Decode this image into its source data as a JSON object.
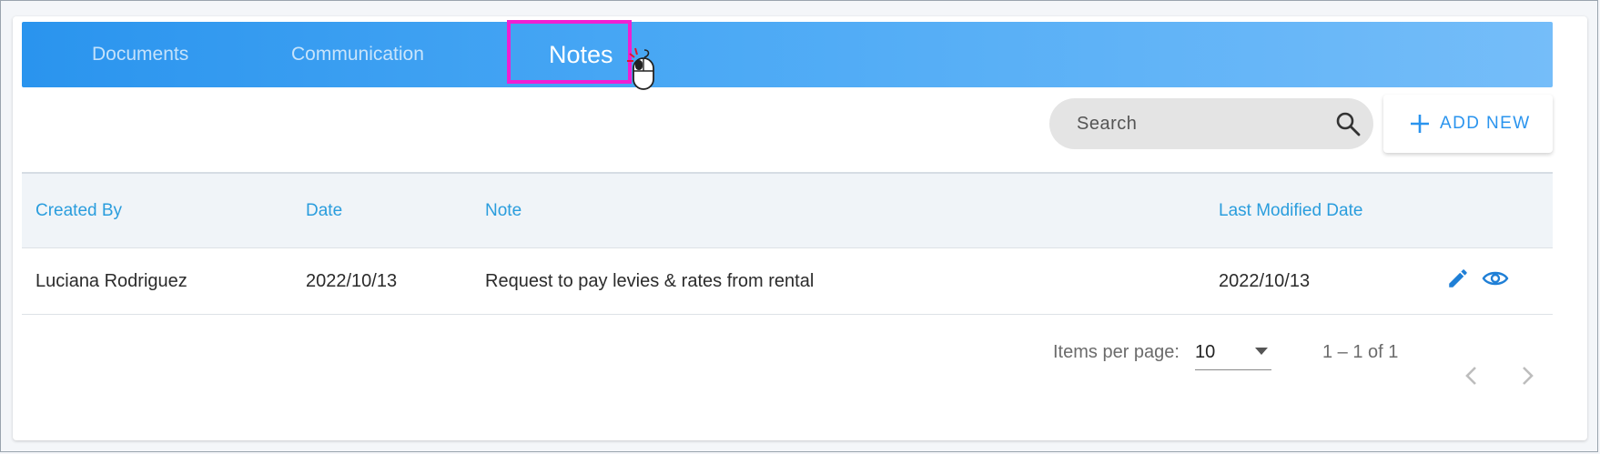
{
  "tabs": [
    {
      "label": "Documents"
    },
    {
      "label": "Communication"
    },
    {
      "label": "Notes"
    }
  ],
  "active_tab": "Notes",
  "search": {
    "placeholder": "Search",
    "value": ""
  },
  "add_button": {
    "label": "ADD NEW"
  },
  "table": {
    "columns": [
      "Created By",
      "Date",
      "Note",
      "Last Modified Date"
    ],
    "rows": [
      {
        "created_by": "Luciana Rodriguez",
        "date": "2022/10/13",
        "note": "Request to pay levies & rates from rental",
        "last_modified": "2022/10/13",
        "actions": [
          "edit-icon",
          "view-icon"
        ]
      }
    ]
  },
  "paginator": {
    "items_per_page_label": "Items per page:",
    "items_per_page": "10",
    "range": "1 – 1 of 1"
  },
  "colors": {
    "accent": "#2a94ee",
    "highlight": "#f01fd2",
    "header_text": "#2a9ddd"
  }
}
